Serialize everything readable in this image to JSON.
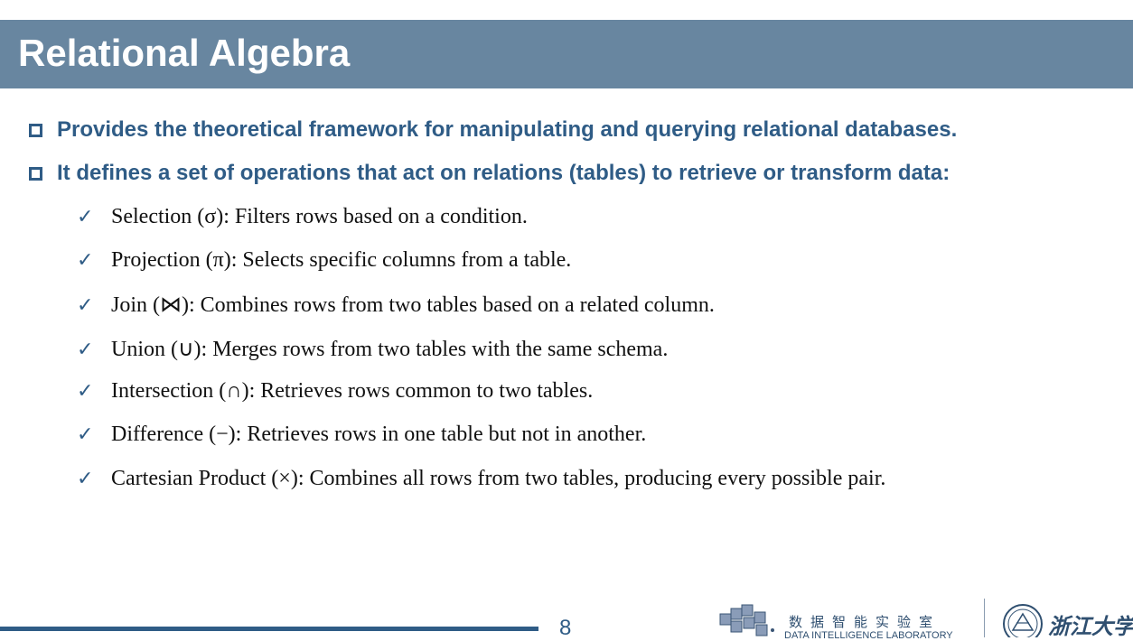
{
  "title": "Relational Algebra",
  "bullets": [
    "Provides the theoretical framework for manipulating and querying relational databases.",
    "It defines a set of operations that act on relations (tables) to retrieve or transform data:"
  ],
  "operations": [
    "Selection (σ): Filters rows based on a condition.",
    "Projection (π): Selects specific columns from a table.",
    "Join (⋈): Combines rows from two tables based on a related column.",
    "Union (∪): Merges rows from two tables with the same schema.",
    "Intersection (∩): Retrieves rows common to two tables.",
    "Difference (−): Retrieves rows in one table but not in another.",
    "Cartesian Product (×): Combines all rows from two tables, producing every possible pair."
  ],
  "check_glyph": "✓",
  "page_number": "8",
  "footer": {
    "lab_name_cn": "数据智能实验室",
    "lab_name_en": "DATA INTELLIGENCE LABORATORY",
    "university_name": "浙江大学"
  },
  "colors": {
    "title_bar": "#6886a0",
    "accent_blue": "#2f5c86"
  }
}
